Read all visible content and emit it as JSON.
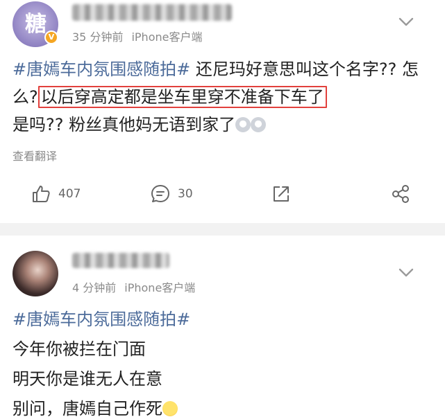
{
  "posts": [
    {
      "avatar_text": "糖",
      "meta": {
        "time": "35 分钟前",
        "source": "iPhone客户端"
      },
      "text": {
        "tag": "#唐嫣车内氛围感随拍#",
        "part1": " 还尼玛好意思叫这个名字?? 怎么?",
        "highlight": "以后穿高定都是坐车里穿不准备下车了",
        "part2": "是吗?? 粉丝真他妈无语到家了"
      },
      "translate_label": "查看翻译",
      "actions": {
        "likes": "407",
        "comments": "30"
      }
    },
    {
      "meta": {
        "time": "4 分钟前",
        "source": "iPhone客户端"
      },
      "text": {
        "tag": "#唐嫣车内氛围感随拍#",
        "line1": "今年你被拦在门面",
        "line2": "明天你是谁无人在意",
        "line3": "别问，唐嫣自己作死"
      }
    }
  ],
  "icons": {
    "verified": "verified-badge-icon",
    "chevron": "chevron-down-icon",
    "like": "thumbs-up-icon",
    "comment": "comment-icon",
    "repost": "repost-icon",
    "share": "share-icon"
  },
  "colors": {
    "hashtag": "#4c6b9a",
    "highlight_box": "#e2403c",
    "meta": "#8a8a8a"
  }
}
